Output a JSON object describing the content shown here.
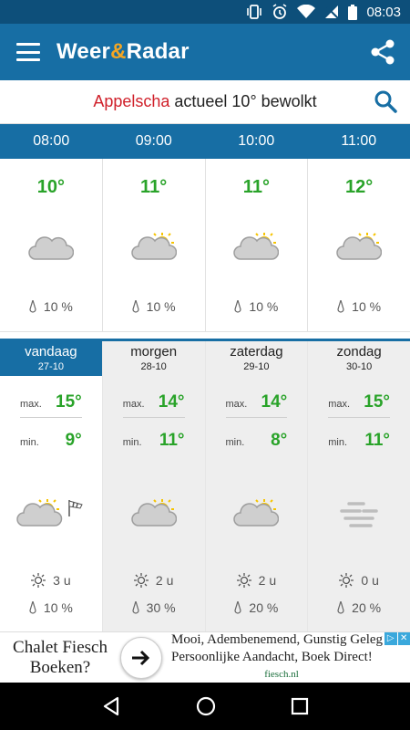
{
  "status_bar": {
    "time": "08:03"
  },
  "app": {
    "title_part1": "Weer",
    "title_amp": "&",
    "title_part2": "Radar"
  },
  "location": {
    "place": "Appelscha",
    "summary": " actueel 10° bewolkt"
  },
  "hourly": [
    {
      "time": "08:00",
      "temp": "10°",
      "icon": "cloud-icon",
      "precip": "10 %"
    },
    {
      "time": "09:00",
      "temp": "11°",
      "icon": "partly-sunny-icon",
      "precip": "10 %"
    },
    {
      "time": "10:00",
      "temp": "11°",
      "icon": "partly-sunny-icon",
      "precip": "10 %"
    },
    {
      "time": "11:00",
      "temp": "12°",
      "icon": "partly-sunny-icon",
      "precip": "10 %"
    }
  ],
  "daily": [
    {
      "name": "vandaag",
      "date": "27-10",
      "max_label": "max.",
      "max": "15°",
      "min_label": "min.",
      "min": "9°",
      "icon": "partly-sunny-windy-icon",
      "sun": "3 u",
      "precip": "10 %"
    },
    {
      "name": "morgen",
      "date": "28-10",
      "max_label": "max.",
      "max": "14°",
      "min_label": "min.",
      "min": "11°",
      "icon": "partly-sunny-icon",
      "sun": "2 u",
      "precip": "30 %"
    },
    {
      "name": "zaterdag",
      "date": "29-10",
      "max_label": "max.",
      "max": "14°",
      "min_label": "min.",
      "min": "8°",
      "icon": "partly-sunny-icon",
      "sun": "2 u",
      "precip": "20 %"
    },
    {
      "name": "zondag",
      "date": "30-10",
      "max_label": "max.",
      "max": "15°",
      "min_label": "min.",
      "min": "11°",
      "icon": "fog-icon",
      "sun": "0 u",
      "precip": "20 %"
    }
  ],
  "ad": {
    "left_line1": "Chalet Fiesch",
    "left_line2": "Boeken?",
    "right_line1": "Mooi, Adembenemend, Gunstig Geleg",
    "right_line2": "Persoonlijke Aandacht, Boek Direct!",
    "domain": "fiesch.nl"
  },
  "colors": {
    "primary": "#176ea4",
    "status": "#0d4f7a",
    "accent_red": "#d0202a",
    "temp_green": "#29a329"
  }
}
